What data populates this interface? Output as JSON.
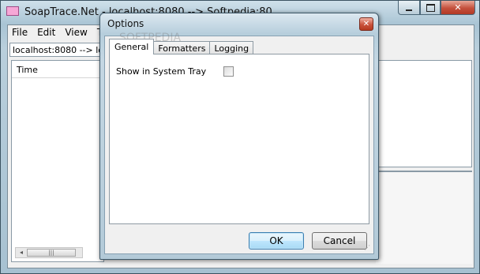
{
  "main_window": {
    "title": "SoapTrace.Net - localhost:8080 --> Softpedia:80",
    "menu": [
      "File",
      "Edit",
      "View",
      "T"
    ],
    "connection_combo": "localhost:8080 --> localhost",
    "list_header": "Time",
    "scroll_thumb": "|||",
    "scroll_left": "◂",
    "caption": {
      "minimize": "",
      "maximize": "",
      "close": "✕"
    }
  },
  "dialog": {
    "title": "Options",
    "close": "✕",
    "tabs": [
      "General",
      "Formatters",
      "Logging"
    ],
    "active_tab": "General",
    "general": {
      "show_in_tray_label": "Show in System Tray",
      "show_in_tray_checked": false
    },
    "buttons": {
      "ok": "OK",
      "cancel": "Cancel"
    },
    "watermark": "SOFTPEDIA",
    "grip": "⋰"
  },
  "colors": {
    "titlebar": "#b6cedc",
    "close_button": "#c9523c",
    "default_button_border": "#3c7fb1"
  }
}
